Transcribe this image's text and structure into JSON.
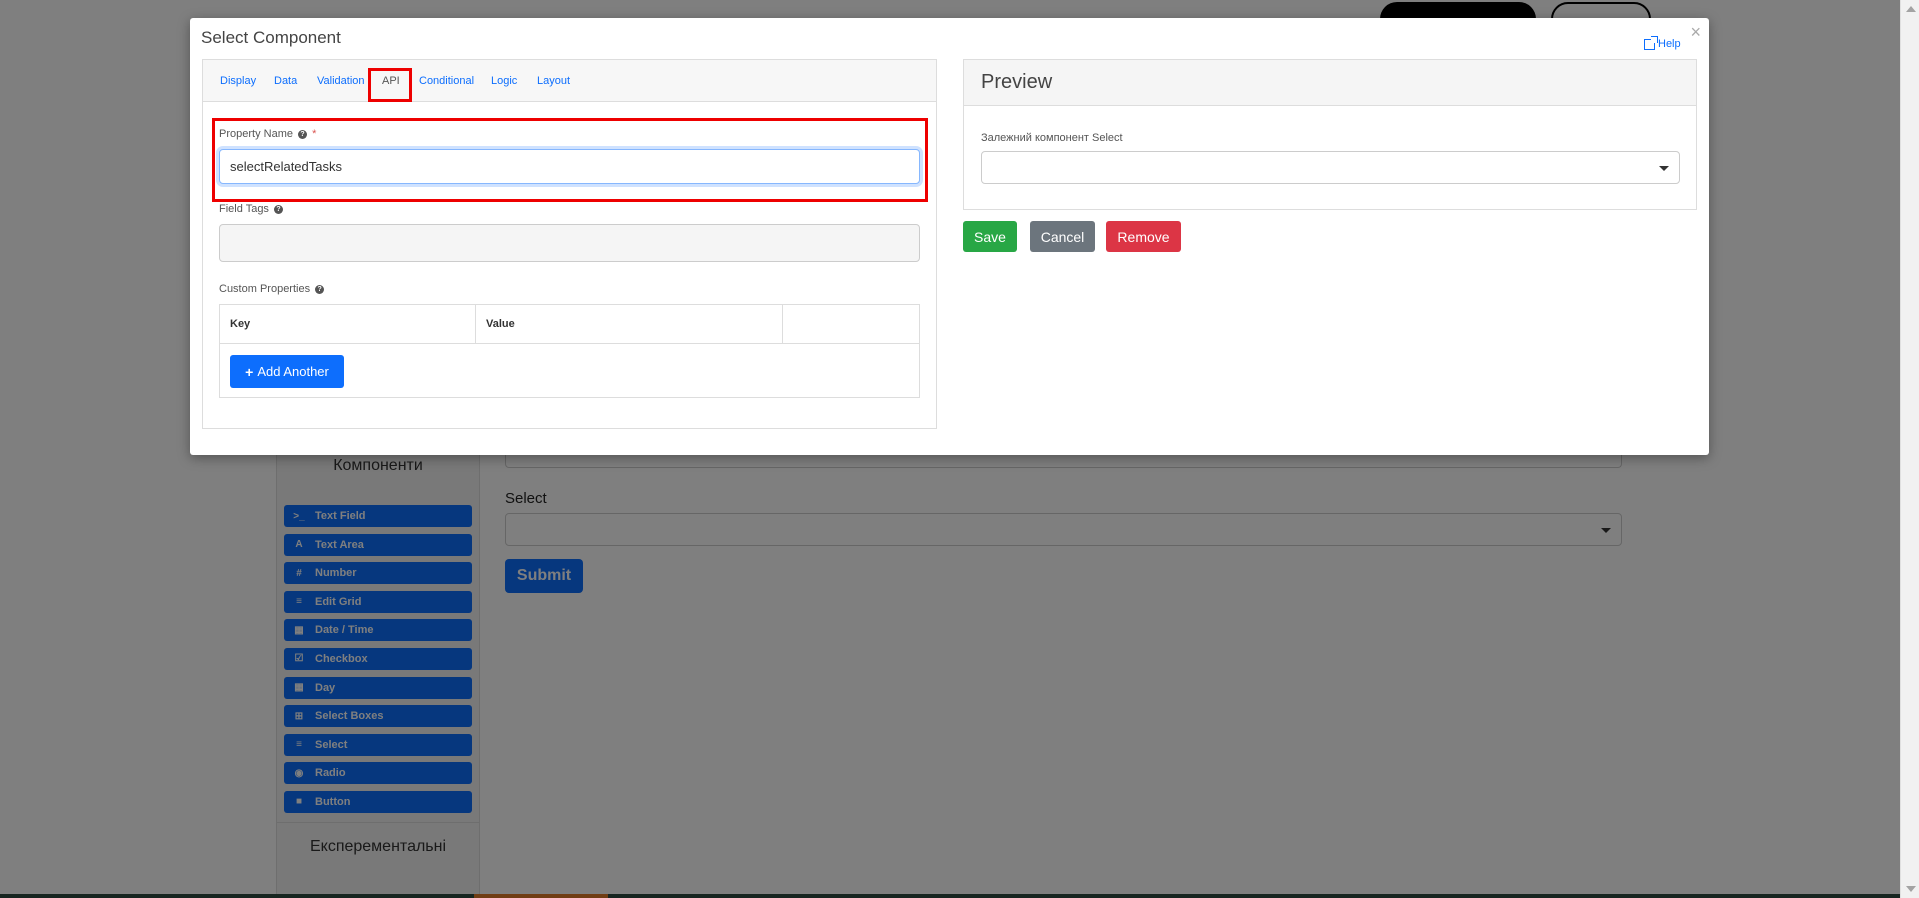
{
  "background": {
    "sidebar_title": "Компоненти",
    "components": [
      {
        "icon": ">_",
        "icon_name": "terminal-icon",
        "label": "Text Field"
      },
      {
        "icon": "A",
        "icon_name": "font-icon",
        "label": "Text Area"
      },
      {
        "icon": "#",
        "icon_name": "hash-icon",
        "label": "Number"
      },
      {
        "icon": "≡",
        "icon_name": "list-icon",
        "label": "Edit Grid"
      },
      {
        "icon": "▦",
        "icon_name": "calendar-icon",
        "label": "Date / Time"
      },
      {
        "icon": "☑",
        "icon_name": "checkbox-icon",
        "label": "Checkbox"
      },
      {
        "icon": "▦",
        "icon_name": "calendar-icon",
        "label": "Day"
      },
      {
        "icon": "⊞",
        "icon_name": "plus-square-icon",
        "label": "Select Boxes"
      },
      {
        "icon": "≡",
        "icon_name": "list-icon",
        "label": "Select"
      },
      {
        "icon": "◉",
        "icon_name": "radio-icon",
        "label": "Radio"
      },
      {
        "icon": "■",
        "icon_name": "stop-icon",
        "label": "Button"
      }
    ],
    "experimental_title": "Експерементальні",
    "select_label": "Select",
    "submit_label": "Submit"
  },
  "modal": {
    "title": "Select Component",
    "close_glyph": "×",
    "help_label": "Help",
    "tabs": [
      {
        "label": "Display"
      },
      {
        "label": "Data"
      },
      {
        "label": "Validation"
      },
      {
        "label": "API"
      },
      {
        "label": "Conditional"
      },
      {
        "label": "Logic"
      },
      {
        "label": "Layout"
      }
    ],
    "active_tab": "API",
    "property_name": {
      "label": "Property Name",
      "required_mark": "*",
      "value": "selectRelatedTasks"
    },
    "field_tags": {
      "label": "Field Tags",
      "value": ""
    },
    "custom_properties": {
      "label": "Custom Properties",
      "columns": [
        "Key",
        "Value"
      ],
      "add_button": "Add Another"
    },
    "preview": {
      "title": "Preview",
      "field_label": "Залежний компонент Select"
    },
    "buttons": {
      "save": "Save",
      "cancel": "Cancel",
      "remove": "Remove"
    }
  },
  "colors": {
    "primary": "#0d6efd",
    "success": "#28a745",
    "secondary": "#6c757d",
    "danger": "#dc3545",
    "highlight": "#ee0000"
  }
}
